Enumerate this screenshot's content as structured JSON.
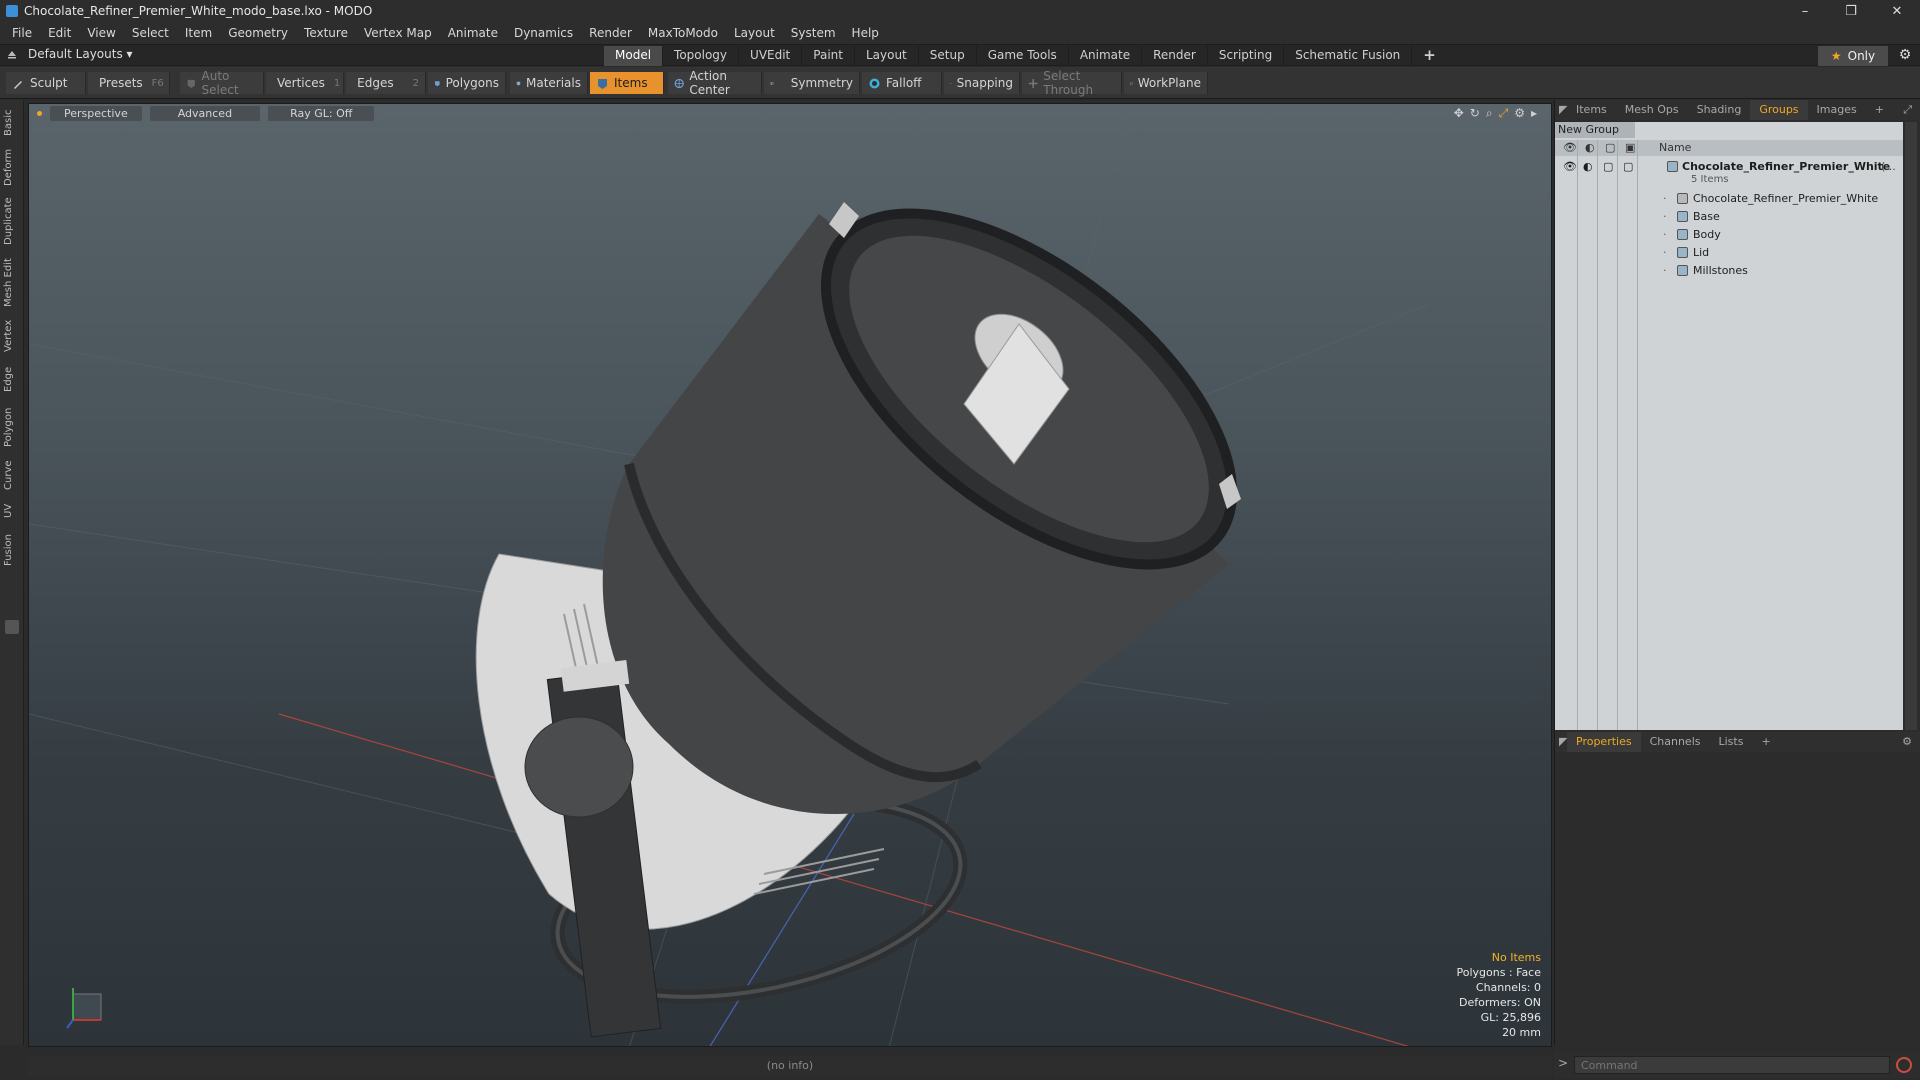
{
  "window": {
    "title": "Chocolate_Refiner_Premier_White_modo_base.lxo - MODO",
    "controls": [
      "–",
      "❐",
      "✕"
    ]
  },
  "menu": [
    "File",
    "Edit",
    "View",
    "Select",
    "Item",
    "Geometry",
    "Texture",
    "Vertex Map",
    "Animate",
    "Dynamics",
    "Render",
    "MaxToModo",
    "Layout",
    "System",
    "Help"
  ],
  "layoutbar": {
    "layout_label": "Default Layouts ▾",
    "tabs": [
      "Model",
      "Topology",
      "UVEdit",
      "Paint",
      "Layout",
      "Setup",
      "Game Tools",
      "Animate",
      "Render",
      "Scripting",
      "Schematic Fusion"
    ],
    "active_tab": "Model",
    "only_label": "Only"
  },
  "toolbar": {
    "sculpt": "Sculpt",
    "presets": "Presets",
    "presets_key": "F6",
    "auto_select": "Auto Select",
    "vertices": "Vertices",
    "vertices_count": "1",
    "edges": "Edges",
    "edges_count": "2",
    "polygons": "Polygons",
    "materials": "Materials",
    "items": "Items",
    "action_center": "Action Center",
    "symmetry": "Symmetry",
    "falloff": "Falloff",
    "snapping": "Snapping",
    "select_through": "Select Through",
    "workplane": "WorkPlane"
  },
  "left_tabs": [
    "Basic",
    "Deform",
    "Duplicate",
    "Mesh Edit",
    "Vertex",
    "Edge",
    "Polygon",
    "Curve",
    "UV",
    "Fusion"
  ],
  "viewport": {
    "view_mode": "Perspective",
    "shading": "Advanced",
    "raygl": "Ray GL: Off",
    "stats": {
      "selection": "No Items",
      "polygons": "Polygons : Face",
      "channels": "Channels: 0",
      "deformers": "Deformers: ON",
      "gl": "GL: 25,896",
      "scale": "20 mm"
    }
  },
  "right_panel": {
    "top_tabs": [
      "Items",
      "Mesh Ops",
      "Shading",
      "Groups",
      "Images"
    ],
    "active_top_tab": "Groups",
    "new_group": "New Group",
    "name_header": "Name",
    "group": {
      "name": "Chocolate_Refiner_Premier_White",
      "suffix": "(...",
      "count": "5 Items",
      "children": [
        "Chocolate_Refiner_Premier_White",
        "Base",
        "Body",
        "Lid",
        "Millstones"
      ]
    },
    "bottom_tabs": [
      "Properties",
      "Channels",
      "Lists"
    ],
    "active_bottom_tab": "Properties"
  },
  "status": {
    "info": "(no info)",
    "command_placeholder": "Command"
  },
  "colors": {
    "accent": "#f0a826",
    "items_button": "#e8922d",
    "record": "#c7503f"
  }
}
